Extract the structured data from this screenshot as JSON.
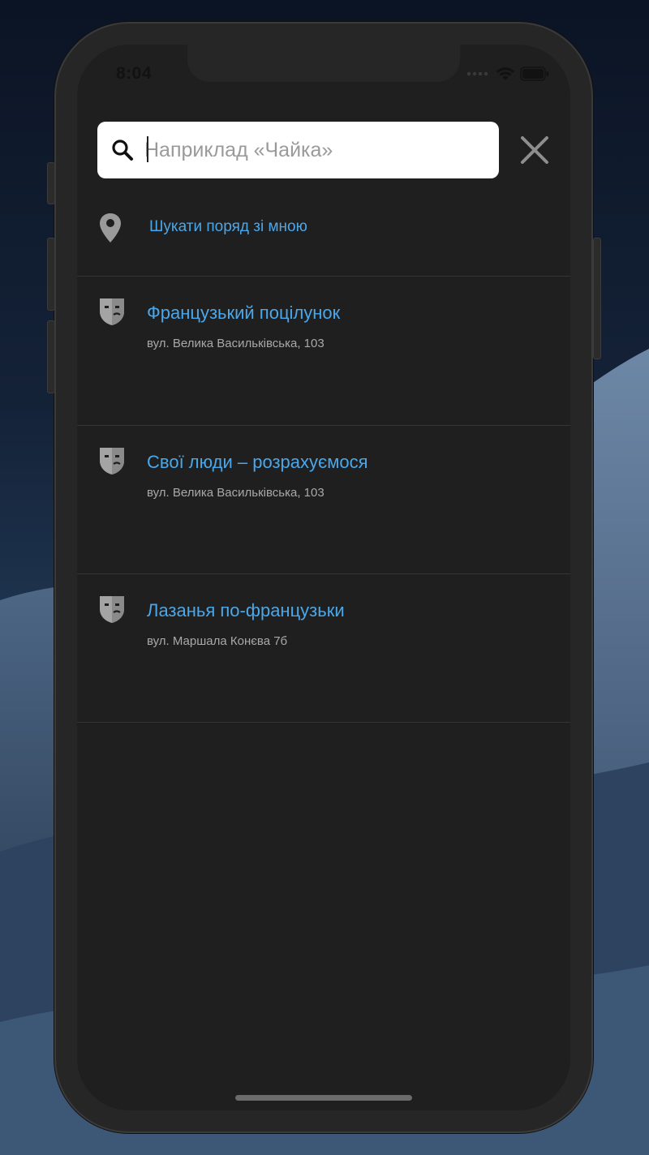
{
  "status_bar": {
    "time": "8:04"
  },
  "search": {
    "placeholder": "Наприклад «Чайка»",
    "value": ""
  },
  "nearby": {
    "label": "Шукати поряд зі мною"
  },
  "results": [
    {
      "title": "Французький поцілунок",
      "address": "вул. Велика Васильківська, 103"
    },
    {
      "title": "Свої люди – розрахуємося",
      "address": "вул. Велика Васильківська, 103"
    },
    {
      "title": "Лазанья по-французьки",
      "address": "вул. Маршала Конєва 7б"
    }
  ],
  "icons": {
    "search": "search-icon",
    "close": "close-icon",
    "location": "location-pin-icon",
    "theatre": "theatre-mask-icon",
    "wifi": "wifi-icon",
    "battery": "battery-icon",
    "signal": "signal-icon"
  },
  "colors": {
    "accent": "#4aa7ea",
    "background": "#1f1f1f",
    "divider": "#353535",
    "secondary_text": "#a9a9a9"
  }
}
